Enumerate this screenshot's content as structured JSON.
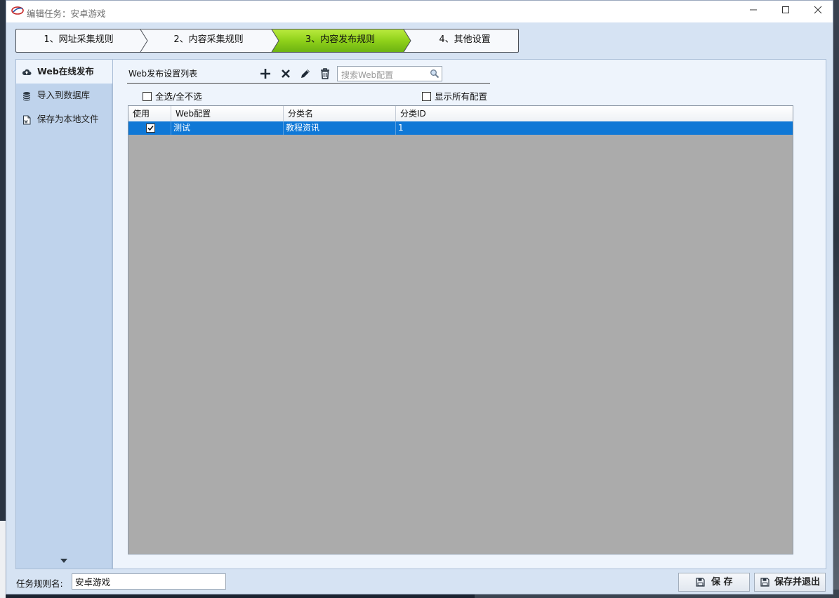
{
  "window": {
    "title": "编辑任务：安卓游戏",
    "minimize": "—",
    "maximize": "☐",
    "close": "✕"
  },
  "steps": [
    {
      "label": "1、网址采集规则",
      "active": false
    },
    {
      "label": "2、内容采集规则",
      "active": false
    },
    {
      "label": "3、内容发布规则",
      "active": true
    },
    {
      "label": "4、其他设置",
      "active": false
    }
  ],
  "nav": {
    "items": [
      {
        "label": "Web在线发布",
        "icon": "cloud-upload-icon",
        "active": true
      },
      {
        "label": "导入到数据库",
        "icon": "database-icon",
        "active": false
      },
      {
        "label": "保存为本地文件",
        "icon": "file-icon",
        "active": false
      }
    ]
  },
  "panel": {
    "list_title": "Web发布设置列表",
    "search_placeholder": "搜索Web配置",
    "select_all_label": "全选/全不选",
    "show_all_label": "显示所有配置",
    "toolbar": [
      "add-icon",
      "delete-icon",
      "edit-icon",
      "trash-icon"
    ]
  },
  "grid": {
    "columns": [
      "使用",
      "Web配置",
      "分类名",
      "分类ID"
    ],
    "rows": [
      {
        "use": true,
        "web_config": "测试",
        "category_name": "教程资讯",
        "category_id": "1",
        "selected": true
      }
    ]
  },
  "footer": {
    "task_name_label": "任务规则名:",
    "task_name_value": "安卓游戏",
    "save_label": "保 存",
    "save_exit_label": "保存并退出"
  },
  "colors": {
    "active_step": "#8fd11a",
    "selected_row": "#0f78d6",
    "nav_bg": "#bfd3ec",
    "panel_bg": "#eef4fc",
    "grid_empty": "#ababab"
  }
}
